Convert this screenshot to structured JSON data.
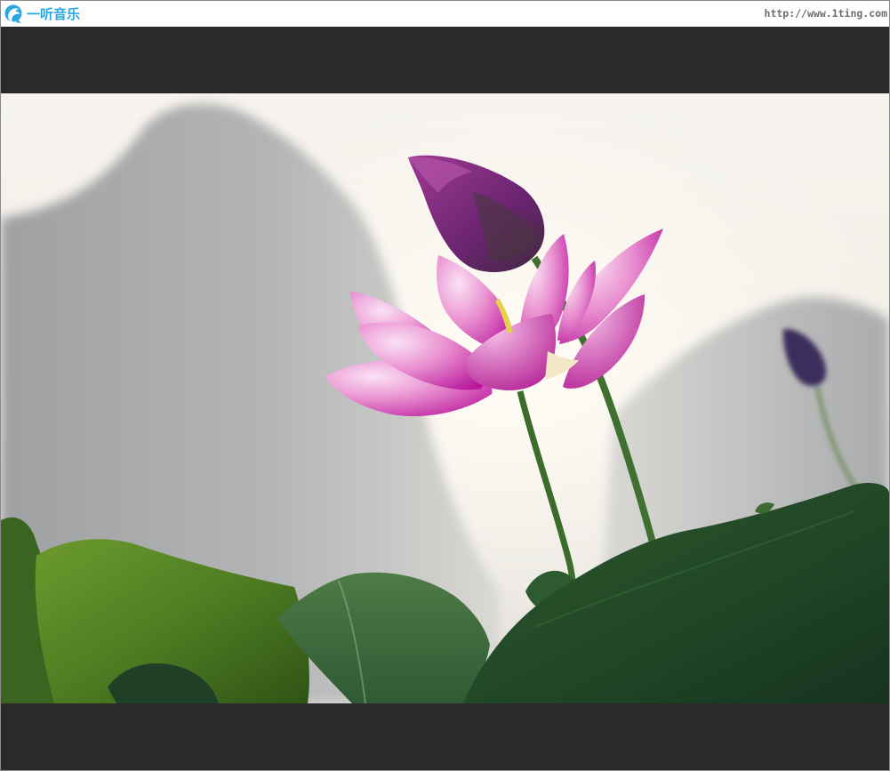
{
  "header": {
    "logo_text": "一听音乐",
    "logo_icon": "dolphin-icon",
    "site_url": "http://www.1ting.com"
  },
  "colors": {
    "brand": "#2aa6e0",
    "band": "#2a2a2a",
    "url_text": "#6e6e6e"
  }
}
